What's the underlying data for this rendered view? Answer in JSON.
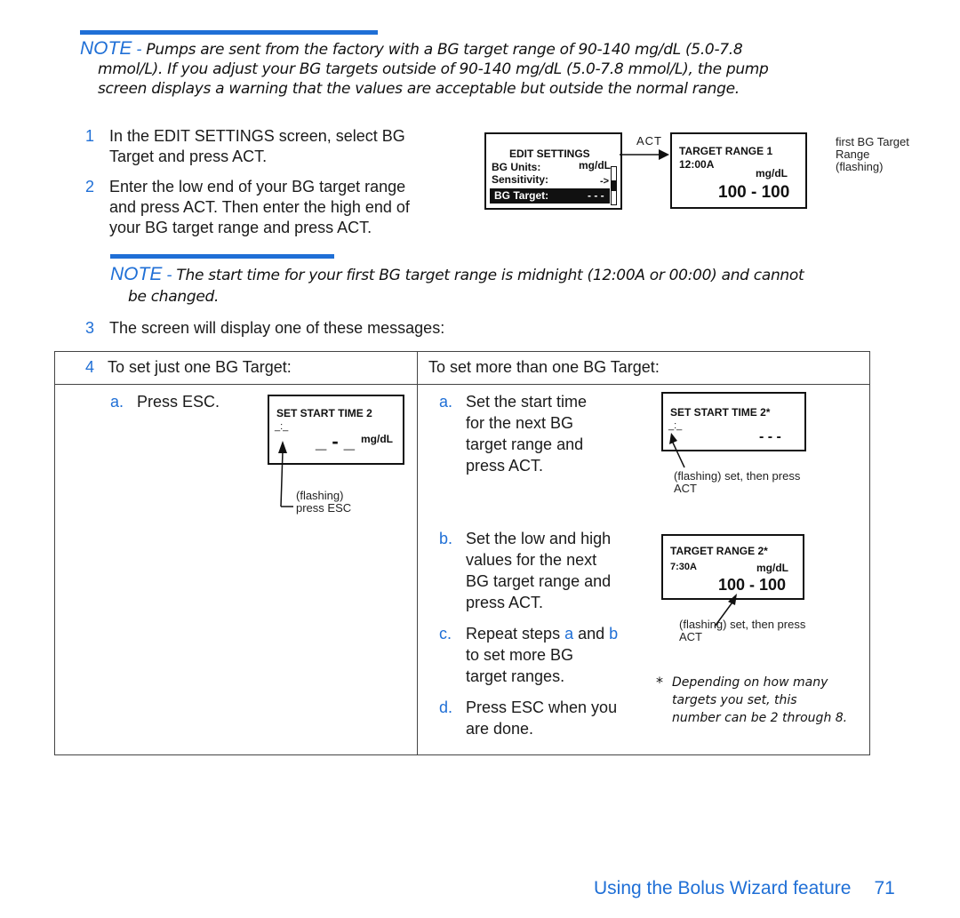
{
  "note1": {
    "label": "NOTE",
    "dash": " - ",
    "line1": "Pumps are sent from the factory with a BG target range of 90-140 mg/dL (5.0-7.8",
    "line2": "mmol/L). If you adjust your BG targets outside of 90-140 mg/dL (5.0-7.8 mmol/L), the pump",
    "line3": "screen displays a warning that the values are acceptable but outside the normal range."
  },
  "steps": [
    {
      "num": "1",
      "lines": [
        "In the EDIT SETTINGS screen, select BG",
        "Target and press ACT."
      ]
    },
    {
      "num": "2",
      "lines": [
        "Enter the low end of your BG target range",
        "and press ACT. Then enter the high end of",
        "your BG target range and press ACT."
      ]
    },
    {
      "num": "3",
      "lines": [
        "The screen will display one of these messages:"
      ]
    }
  ],
  "edit_settings_screen": {
    "title": "EDIT SETTINGS",
    "rows": [
      {
        "label": "BG Units:",
        "value": "mg/dL"
      },
      {
        "label": "Sensitivity:",
        "value": "->"
      },
      {
        "label": "BG Target:",
        "value": "- - -",
        "selected": true
      }
    ]
  },
  "arrow_label": "ACT",
  "target_range_1_screen": {
    "title": "TARGET RANGE 1",
    "time": "12:00A",
    "units": "mg/dL",
    "value": "100 - 100"
  },
  "target_range_1_caption": [
    "first BG Target",
    "Range",
    "(flashing)"
  ],
  "note2": {
    "label": "NOTE",
    "dash": " - ",
    "line1": "The start time for your first BG target range is midnight (12:00A or 00:00) and cannot",
    "line2": "be changed."
  },
  "table": {
    "step_num": "4",
    "col1_header": "To set just one BG Target:",
    "col2_header": "To set more than one BG Target:",
    "col1_items": [
      {
        "letter": "a.",
        "text": "Press ESC."
      }
    ],
    "col1_screen": {
      "title": "SET START TIME 2",
      "time": "_:_",
      "value": "_ - _",
      "units": "mg/dL"
    },
    "col1_caption": [
      "(flashing)",
      "press ESC"
    ],
    "col2_items": [
      {
        "letter": "a.",
        "lines": [
          "Set the start time",
          "for the next BG",
          "target range and",
          "press ACT."
        ]
      },
      {
        "letter": "b.",
        "lines": [
          "Set the low and high",
          "values for the next",
          "BG target range and",
          "press ACT."
        ]
      },
      {
        "letter": "c.",
        "prefix": "Repeat steps ",
        "ref_a": "a",
        "mid": " and ",
        "ref_b": "b",
        "lines": [
          "to set more BG",
          "target ranges."
        ]
      },
      {
        "letter": "d.",
        "lines": [
          "Press ESC when you",
          "are done."
        ]
      }
    ],
    "col2_screen_a": {
      "title": "SET START TIME 2*",
      "time": "_:_",
      "value": "- - -"
    },
    "col2_caption_a": [
      "(flashing) set, then press",
      "ACT"
    ],
    "col2_screen_b": {
      "title": "TARGET RANGE 2*",
      "time": "7:30A",
      "units": "mg/dL",
      "value": "100 - 100"
    },
    "col2_caption_b": [
      "(flashing) set, then press",
      "ACT"
    ],
    "footnote": {
      "mark": "*",
      "lines": [
        "Depending on how many",
        "targets you set, this",
        "number can be 2 through 8."
      ]
    }
  },
  "footer": {
    "section": "Using the Bolus Wizard feature",
    "page": "71"
  }
}
